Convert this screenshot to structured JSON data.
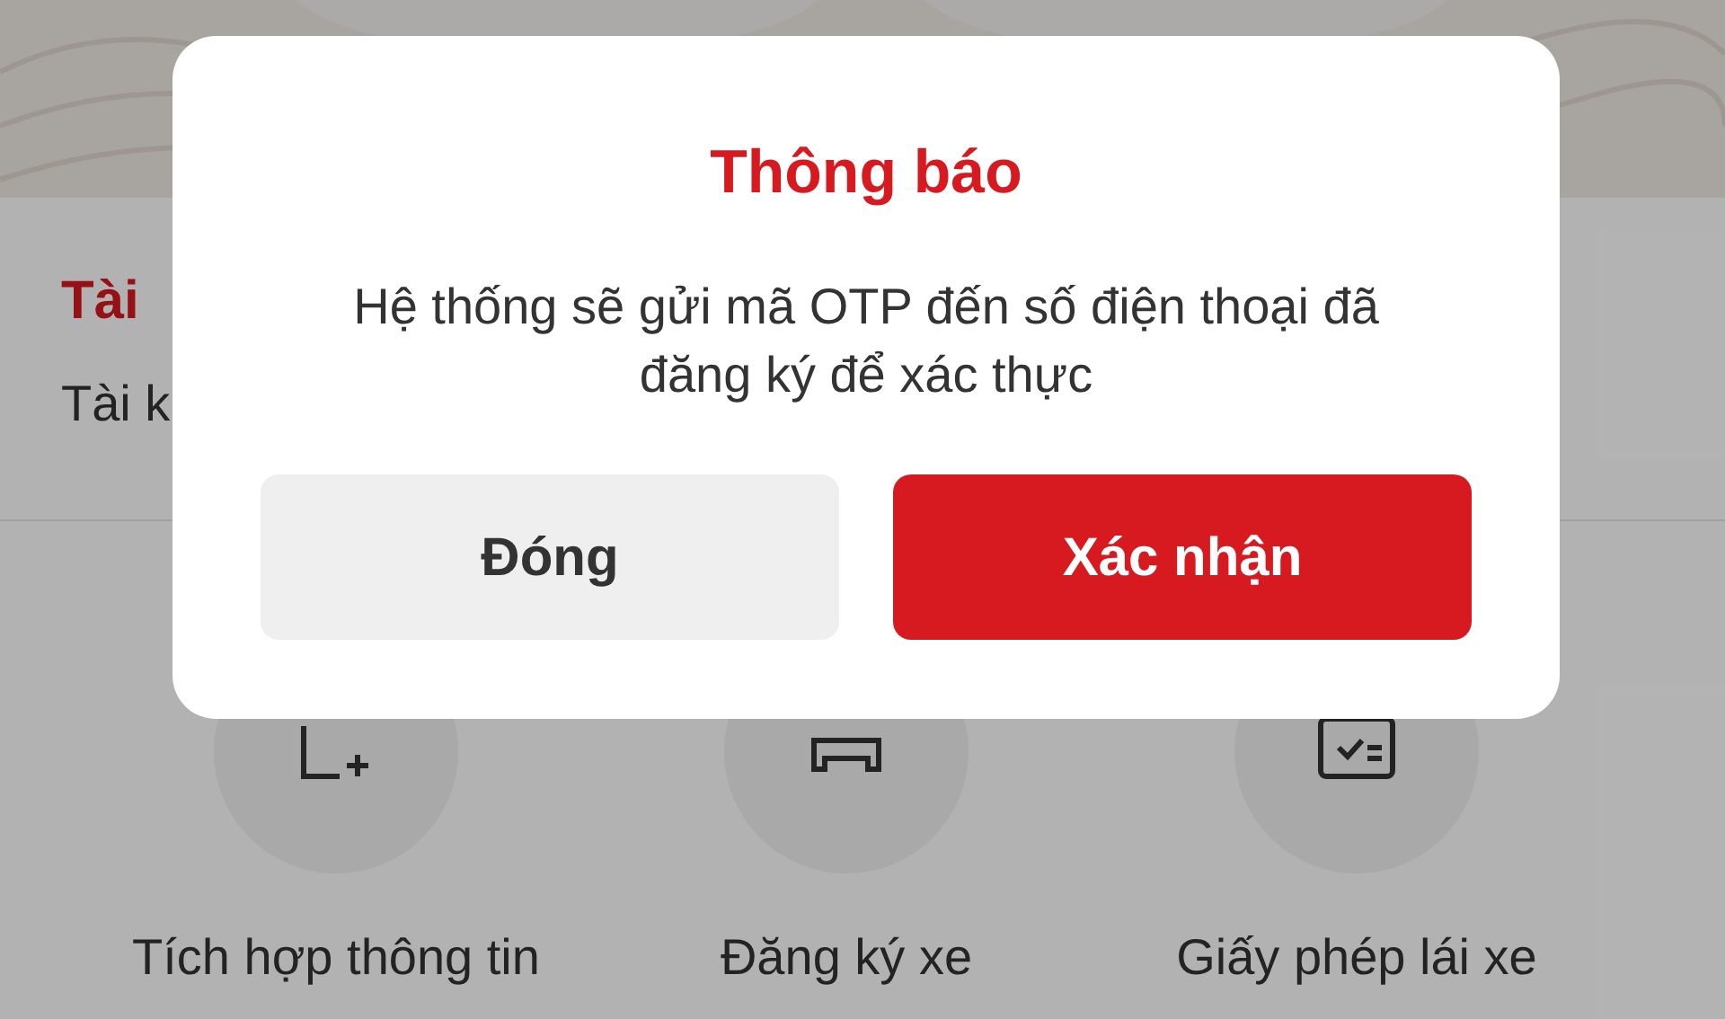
{
  "account_section": {
    "title": "Tài",
    "subtitle": "Tài k"
  },
  "services": [
    {
      "label": "Tích hợp thông tin",
      "kind": "integrate"
    },
    {
      "label": "Đăng ký xe",
      "kind": "vehicle"
    },
    {
      "label": "Giấy phép lái xe",
      "kind": "license"
    }
  ],
  "dialog": {
    "title": "Thông báo",
    "message": "Hệ thống sẽ gửi mã OTP đến số điện thoại đã đăng ký để xác thực",
    "buttons": [
      {
        "label": "Đóng",
        "kind": "secondary"
      },
      {
        "label": "Xác nhận",
        "kind": "primary"
      }
    ]
  }
}
